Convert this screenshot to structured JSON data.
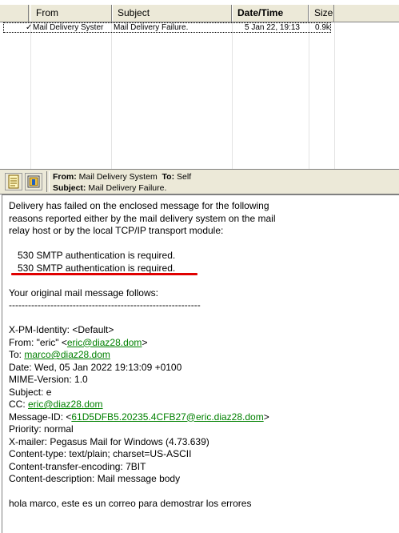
{
  "list": {
    "columns": [
      {
        "label": "From"
      },
      {
        "label": "Subject"
      },
      {
        "label": "Date/Time"
      },
      {
        "label": "Size"
      }
    ],
    "rows": [
      {
        "mark": "✓",
        "from": "Mail Delivery Syster",
        "subject": "Mail Delivery Failure.",
        "date": "5 Jan 22, 19:13",
        "size": "0.9k"
      }
    ]
  },
  "header_bar": {
    "from_label": "From:",
    "from_value": "Mail Delivery System",
    "to_label": "To:",
    "to_value": "Self",
    "subject_label": "Subject:",
    "subject_value": "Mail Delivery Failure.",
    "icons": [
      "notepad-icon",
      "attachment-view-icon"
    ]
  },
  "body": {
    "intro": [
      "Delivery has failed on the enclosed message for the following",
      "reasons reported either by the mail delivery system on the mail",
      "relay host or by the local TCP/IP transport module:"
    ],
    "errors": [
      "530 SMTP authentication is required.",
      "530 SMTP authentication is required."
    ],
    "follows": "Your original mail message follows:",
    "separator": "------------------------------------------------------------",
    "identity": "X-PM-Identity: <Default>",
    "from_prefix": "From: \"eric\" <",
    "from_email": "eric@diaz28.dom",
    "from_suffix": ">",
    "to_prefix": "To: ",
    "to_email": "marco@diaz28.dom",
    "date": "Date: Wed, 05 Jan 2022 19:13:09 +0100",
    "mime": "MIME-Version: 1.0",
    "subject": "Subject: e",
    "cc_prefix": "CC: ",
    "cc_email": "eric@diaz28.dom",
    "msgid_prefix": "Message-ID: <",
    "msgid_value": "61D5DFB5.20235.4CFB27@eric.diaz28.dom",
    "msgid_suffix": ">",
    "priority": "Priority: normal",
    "mailer": "X-mailer: Pegasus Mail for Windows (4.73.639)",
    "content_type": "Content-type: text/plain; charset=US-ASCII",
    "encoding": "Content-transfer-encoding: 7BIT",
    "description": "Content-description: Mail message body",
    "message": "hola marco, este es un correo para demostrar los errores"
  },
  "colors": {
    "chrome": "#ece9d8",
    "link": "#008000",
    "annotation": "#e00000"
  }
}
